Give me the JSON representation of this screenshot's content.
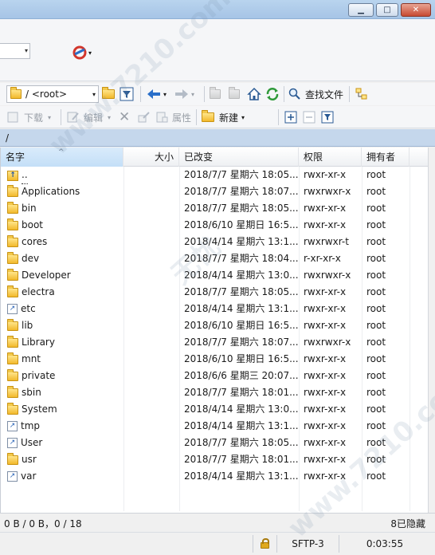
{
  "window": {
    "minimize": "▁",
    "maximize": "□",
    "close": "✕"
  },
  "toolbar_top": {
    "combo_arrow": "▾"
  },
  "toolbar_nav": {
    "path_combo": "/ <root>",
    "find_files_label": "查找文件"
  },
  "toolbar_actions": {
    "download_label": "下载",
    "edit_label": "编辑",
    "properties_label": "属性",
    "new_label": "新建"
  },
  "path_bar": {
    "path": "/"
  },
  "columns": {
    "name": "名字",
    "size": "大小",
    "changed": "已改变",
    "rights": "权限",
    "owner": "拥有者"
  },
  "files": [
    {
      "name": "..",
      "type": "parent",
      "changed": "2018/7/7 星期六 18:05...",
      "rights": "rwxr-xr-x",
      "owner": "root"
    },
    {
      "name": "Applications",
      "type": "folder",
      "changed": "2018/7/7 星期六 18:07...",
      "rights": "rwxrwxr-x",
      "owner": "root"
    },
    {
      "name": "bin",
      "type": "folder",
      "changed": "2018/7/7 星期六 18:05...",
      "rights": "rwxr-xr-x",
      "owner": "root"
    },
    {
      "name": "boot",
      "type": "folder",
      "changed": "2018/6/10 星期日 16:5...",
      "rights": "rwxr-xr-x",
      "owner": "root"
    },
    {
      "name": "cores",
      "type": "folder",
      "changed": "2018/4/14 星期六 13:1...",
      "rights": "rwxrwxr-t",
      "owner": "root"
    },
    {
      "name": "dev",
      "type": "folder",
      "changed": "2018/7/7 星期六 18:04...",
      "rights": "r-xr-xr-x",
      "owner": "root"
    },
    {
      "name": "Developer",
      "type": "folder",
      "changed": "2018/4/14 星期六 13:0...",
      "rights": "rwxrwxr-x",
      "owner": "root"
    },
    {
      "name": "electra",
      "type": "folder",
      "changed": "2018/7/7 星期六 18:05...",
      "rights": "rwxr-xr-x",
      "owner": "root"
    },
    {
      "name": "etc",
      "type": "link",
      "changed": "2018/4/14 星期六 13:1...",
      "rights": "rwxr-xr-x",
      "owner": "root"
    },
    {
      "name": "lib",
      "type": "folder",
      "changed": "2018/6/10 星期日 16:5...",
      "rights": "rwxr-xr-x",
      "owner": "root"
    },
    {
      "name": "Library",
      "type": "folder",
      "changed": "2018/7/7 星期六 18:07...",
      "rights": "rwxrwxr-x",
      "owner": "root"
    },
    {
      "name": "mnt",
      "type": "folder",
      "changed": "2018/6/10 星期日 16:5...",
      "rights": "rwxr-xr-x",
      "owner": "root"
    },
    {
      "name": "private",
      "type": "folder",
      "changed": "2018/6/6 星期三 20:07...",
      "rights": "rwxr-xr-x",
      "owner": "root"
    },
    {
      "name": "sbin",
      "type": "folder",
      "changed": "2018/7/7 星期六 18:01...",
      "rights": "rwxr-xr-x",
      "owner": "root"
    },
    {
      "name": "System",
      "type": "folder",
      "changed": "2018/4/14 星期六 13:0...",
      "rights": "rwxr-xr-x",
      "owner": "root"
    },
    {
      "name": "tmp",
      "type": "link",
      "changed": "2018/4/14 星期六 13:1...",
      "rights": "rwxr-xr-x",
      "owner": "root"
    },
    {
      "name": "User",
      "type": "link",
      "changed": "2018/7/7 星期六 18:05...",
      "rights": "rwxr-xr-x",
      "owner": "root"
    },
    {
      "name": "usr",
      "type": "folder",
      "changed": "2018/7/7 星期六 18:01...",
      "rights": "rwxr-xr-x",
      "owner": "root"
    },
    {
      "name": "var",
      "type": "link",
      "changed": "2018/4/14 星期六 13:1...",
      "rights": "rwxr-xr-x",
      "owner": "root"
    }
  ],
  "status": {
    "selection": "0 B / 0 B，0 / 18",
    "hidden": "8已隐藏",
    "protocol": "SFTP-3",
    "elapsed": "0:03:55"
  },
  "watermark": {
    "text": "www.7210.com",
    "center": "无忧"
  },
  "colors": {
    "header_sorted": "#c4dff7",
    "path_bar": "#c5d7ec",
    "folder": "#f2b92c"
  }
}
